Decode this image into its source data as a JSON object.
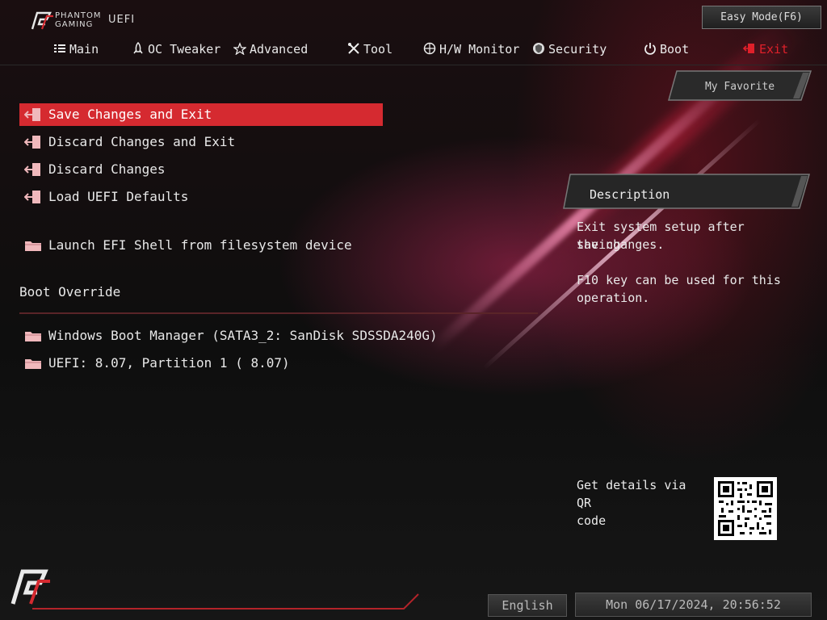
{
  "brand": {
    "line1": "PHANTOM",
    "line2": "GAMING",
    "product": "UEFI"
  },
  "header": {
    "easy_mode_label": "Easy Mode(F6)"
  },
  "tabs": [
    {
      "label": "Main",
      "icon": "list-icon"
    },
    {
      "label": "OC Tweaker",
      "icon": "rocket-icon"
    },
    {
      "label": "Advanced",
      "icon": "star-icon"
    },
    {
      "label": "Tool",
      "icon": "tools-icon"
    },
    {
      "label": "H/W Monitor",
      "icon": "crosshair-icon"
    },
    {
      "label": "Security",
      "icon": "shield-icon"
    },
    {
      "label": "Boot",
      "icon": "power-icon"
    },
    {
      "label": "Exit",
      "icon": "exit-icon",
      "active": true
    }
  ],
  "my_favorite_label": "My Favorite",
  "exit_items": [
    {
      "label": "Save Changes and Exit",
      "selected": true
    },
    {
      "label": "Discard Changes and Exit"
    },
    {
      "label": "Discard Changes"
    },
    {
      "label": "Load UEFI Defaults"
    }
  ],
  "launch_efi_shell": "Launch EFI Shell from filesystem device",
  "boot_override": {
    "title": "Boot Override",
    "items": [
      "Windows Boot Manager (SATA3_2: SanDisk SDSSDA240G)",
      "UEFI:  8.07, Partition 1 ( 8.07)"
    ]
  },
  "description": {
    "title": "Description",
    "line1": "Exit system setup after saving",
    "line2": "the changes.",
    "line3": "F10 key can be used for this",
    "line4": "operation."
  },
  "qr": {
    "line1": "Get details via QR",
    "line2": "code"
  },
  "footer": {
    "language": "English",
    "datetime": "Mon 06/17/2024, 20:56:52"
  },
  "colors": {
    "accent": "#d52a30",
    "active_tab": "#e0202a"
  }
}
